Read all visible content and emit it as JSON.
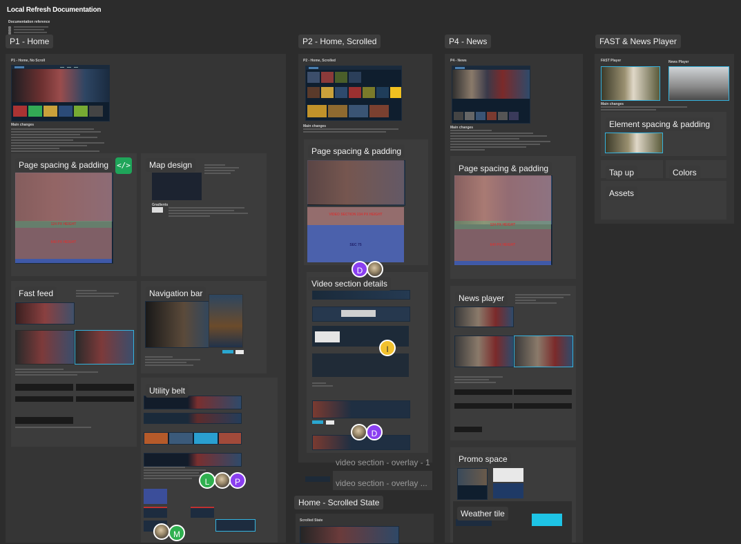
{
  "document": {
    "title": "Local Refresh Documentation",
    "reference_label": "Documentation reference"
  },
  "sections": {
    "p1": "P1 - Home",
    "p2": "P2 - Home, Scrolled",
    "p4": "P4 - News",
    "fast": "FAST & News Player"
  },
  "p1": {
    "frame_title": "P1 - Home, No Scroll",
    "main_changes": "Main changes",
    "page_spacing": "Page spacing & padding",
    "map_design": "Map design",
    "gradients": "Gradients",
    "fast_feed": "Fast feed",
    "navigation_bar": "Navigation bar",
    "utility_belt": "Utility belt",
    "overlay_124": "124 PX HEIGHT",
    "overlay_640": "640 PX HEIGHT"
  },
  "p2": {
    "frame_title": "P2 - Home, Scrolled",
    "main_changes": "Main changes",
    "page_spacing": "Page spacing & padding",
    "video_section_overlay": "VIDEO SECTION 234 PX HEIGHT",
    "overlay_bottom": "SEC 75",
    "video_section_details": "Video section details",
    "overlay_1": "video section - overlay - 1",
    "overlay_2": "video section - overlay ...",
    "scrolled_state": "Home - Scrolled State",
    "scrolled_state_inner": "Scrolled State"
  },
  "p4": {
    "frame_title": "P4 - News",
    "main_changes": "Main changes",
    "page_spacing": "Page spacing & padding",
    "overlay_124": "124 PX HEIGHT",
    "overlay_640": "640 PX HEIGHT",
    "news_player": "News player",
    "promo_space": "Promo space",
    "weather_tile": "Weather tile"
  },
  "fast": {
    "fast_player": "FAST Player",
    "news_player": "News Player",
    "main_changes": "Main changes",
    "element_spacing": "Element spacing & padding",
    "tap_up": "Tap up",
    "colors": "Colors",
    "assets": "Assets"
  },
  "collaborators": [
    {
      "initial": "D",
      "color": "#8a3ff0"
    },
    {
      "initial": "I",
      "color": "#f2c12e"
    },
    {
      "initial": "D",
      "color": "#8a3ff0"
    },
    {
      "initial": "L",
      "color": "#2fb04f"
    },
    {
      "initial": "P",
      "color": "#8a3ff0"
    },
    {
      "initial": "M",
      "color": "#2fb04f"
    }
  ],
  "icons": {
    "embed": "code-embed-icon",
    "avatar_photo": "user-photo-avatar"
  },
  "colors": {
    "canvas": "#2c2c2c",
    "panel": "#353535",
    "accent_green": "#1fa55a",
    "cyan": "#1ec4e6"
  }
}
